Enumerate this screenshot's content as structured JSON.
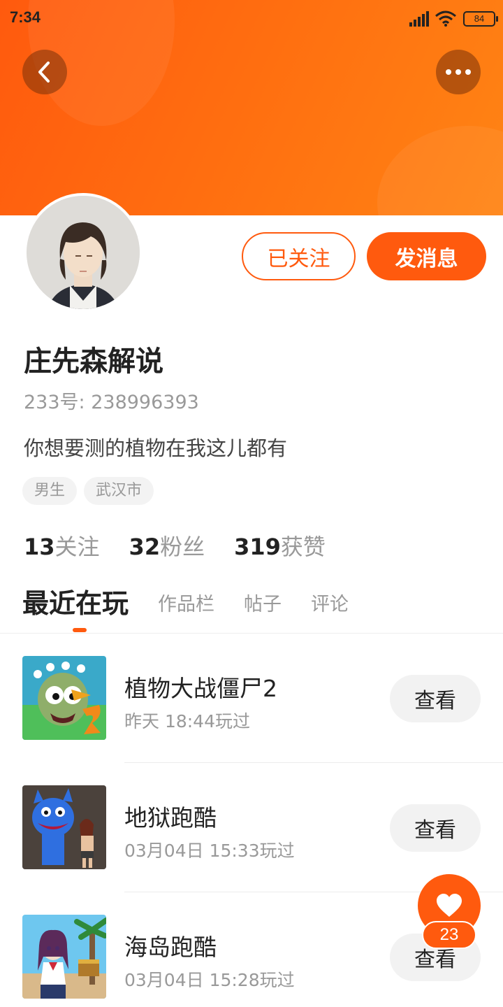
{
  "status_bar": {
    "time": "7:34",
    "battery": "84"
  },
  "header": {
    "back_icon": "chevron-left-icon",
    "more_icon": "more-dots-icon"
  },
  "profile": {
    "follow_label": "已关注",
    "message_label": "发消息",
    "name": "庄先森解说",
    "id_text": "233号: 238996393",
    "bio": "你想要测的植物在我这儿都有",
    "tags": [
      "男生",
      "武汉市"
    ],
    "stats": [
      {
        "num": "13",
        "label": "关注"
      },
      {
        "num": "32",
        "label": "粉丝"
      },
      {
        "num": "319",
        "label": "获赞"
      }
    ]
  },
  "tabs": [
    "最近在玩",
    "作品栏",
    "帖子",
    "评论"
  ],
  "games": [
    {
      "name": "植物大战僵尸2",
      "time": "昨天 18:44玩过",
      "button": "查看"
    },
    {
      "name": "地狱跑酷",
      "time": "03月04日 15:33玩过",
      "button": "查看"
    },
    {
      "name": "海岛跑酷",
      "time": "03月04日 15:28玩过",
      "button": "查看"
    }
  ],
  "like_fab": {
    "icon": "heart-icon",
    "count": "23"
  },
  "colors": {
    "accent": "#ff5a0e",
    "banner_end": "#ff8414"
  }
}
